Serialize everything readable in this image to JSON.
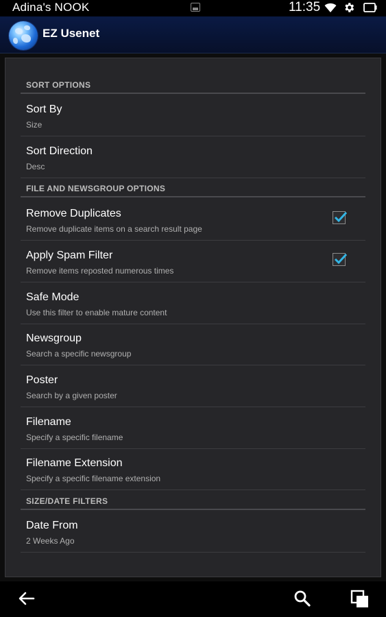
{
  "status_bar": {
    "device_name": "Adina's NOOK",
    "time": "11:35",
    "icons": [
      "image-notification-icon",
      "wifi-icon",
      "settings-gear-icon",
      "battery-icon"
    ]
  },
  "action_bar": {
    "app_icon": "globe-app-icon",
    "title": "EZ Usenet"
  },
  "sections": {
    "sort": {
      "header": "SORT OPTIONS",
      "items": [
        {
          "title": "Sort By",
          "summary": "Size"
        },
        {
          "title": "Sort Direction",
          "summary": "Desc"
        }
      ]
    },
    "file": {
      "header": "FILE AND NEWSGROUP OPTIONS",
      "items": [
        {
          "title": "Remove Duplicates",
          "summary": "Remove duplicate items on a search result page",
          "checked": true
        },
        {
          "title": "Apply Spam Filter",
          "summary": "Remove items reposted numerous times",
          "checked": true
        },
        {
          "title": "Safe Mode",
          "summary": "Use this filter to enable mature content"
        },
        {
          "title": "Newsgroup",
          "summary": "Search a specific newsgroup"
        },
        {
          "title": "Poster",
          "summary": "Search by a given poster"
        },
        {
          "title": "Filename",
          "summary": "Specify a specific filename"
        },
        {
          "title": "Filename Extension",
          "summary": "Specify a specific filename extension"
        }
      ]
    },
    "size_date": {
      "header": "SIZE/DATE FILTERS",
      "items": [
        {
          "title": "Date From",
          "summary": "2 Weeks Ago"
        }
      ]
    }
  },
  "nav_bar": {
    "icons": [
      "back-arrow-icon",
      "search-icon",
      "recent-apps-icon"
    ]
  },
  "colors": {
    "accent_check": "#33b5e5",
    "action_bar": "#0a1a44",
    "panel": "#262629"
  }
}
